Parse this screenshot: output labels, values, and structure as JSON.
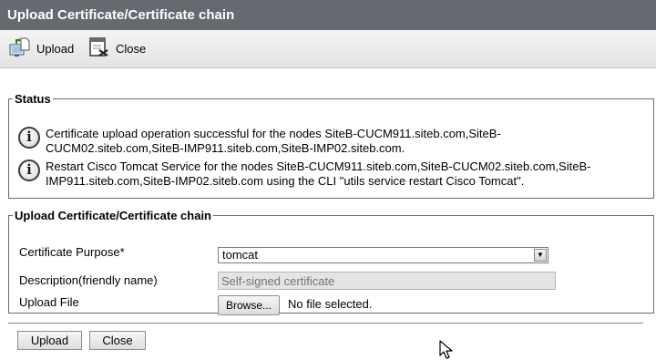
{
  "window": {
    "title": "Upload Certificate/Certificate chain"
  },
  "toolbar": {
    "upload_label": "Upload",
    "close_label": "Close"
  },
  "status": {
    "legend": "Status",
    "messages": [
      "Certificate upload operation successful for the nodes SiteB-CUCM911.siteb.com,SiteB-CUCM02.siteb.com,SiteB-IMP911.siteb.com,SiteB-IMP02.siteb.com.",
      "Restart Cisco Tomcat Service for the nodes SiteB-CUCM911.siteb.com,SiteB-CUCM02.siteb.com,SiteB-IMP911.siteb.com,SiteB-IMP02.siteb.com using the CLI \"utils service restart Cisco Tomcat\"."
    ]
  },
  "upload_section": {
    "legend": "Upload Certificate/Certificate chain",
    "purpose_label": "Certificate Purpose",
    "required_marker": "*",
    "purpose_value": "tomcat",
    "description_label": "Description(friendly name)",
    "description_placeholder": "Self-signed certificate",
    "file_label": "Upload File",
    "browse_label": "Browse...",
    "file_status": "No file selected."
  },
  "buttons": {
    "upload_label": "Upload",
    "close_label": "Close"
  },
  "colors": {
    "titlebar": "#646a70",
    "divider": "#6f8f93"
  }
}
